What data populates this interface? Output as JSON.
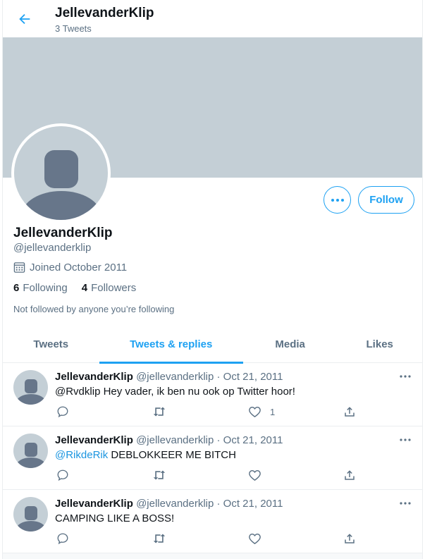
{
  "header": {
    "title": "JellevanderKlip",
    "tweet_count": "3 Tweets"
  },
  "colors": {
    "accent": "#1da1f2",
    "banner": "#c4cfd6",
    "secondary_text": "#5b7083"
  },
  "profile": {
    "name": "JellevanderKlip",
    "handle": "@jellevanderklip",
    "joined": "Joined October 2011",
    "following_count": "6",
    "following_label": "Following",
    "followers_count": "4",
    "followers_label": "Followers",
    "not_followed": "Not followed by anyone you’re following",
    "follow_label": "Follow"
  },
  "tabs": [
    {
      "label": "Tweets",
      "active": false
    },
    {
      "label": "Tweets & replies",
      "active": true
    },
    {
      "label": "Media",
      "active": false
    },
    {
      "label": "Likes",
      "active": false
    }
  ],
  "tweets": [
    {
      "name": "JellevanderKlip",
      "meta": "@jellevanderklip · Oct 21, 2011",
      "mention": "",
      "text": "@Rvdklip Hey vader, ik ben nu ook op Twitter hoor!",
      "like_count": "1"
    },
    {
      "name": "JellevanderKlip",
      "meta": "@jellevanderklip · Oct 21, 2011",
      "mention": "@RikdeRik",
      "text": " DEBLOKKEER ME BITCH",
      "like_count": ""
    },
    {
      "name": "JellevanderKlip",
      "meta": "@jellevanderklip · Oct 21, 2011",
      "mention": "",
      "text": "CAMPING LIKE A BOSS!",
      "like_count": ""
    }
  ]
}
